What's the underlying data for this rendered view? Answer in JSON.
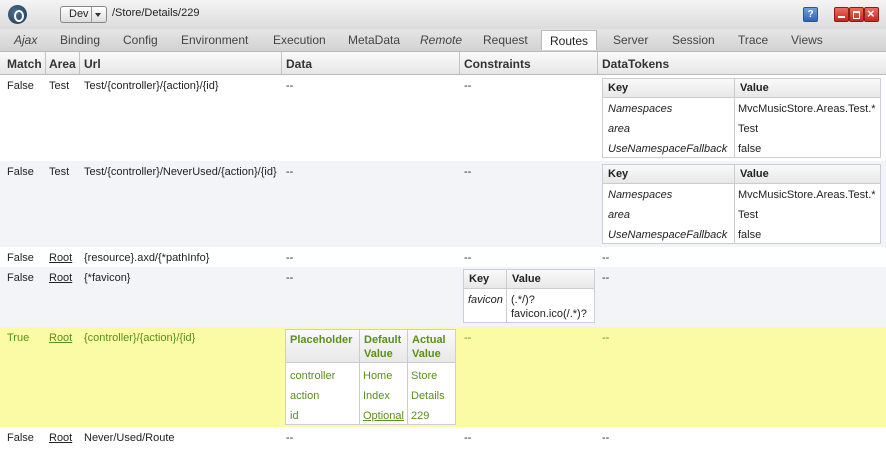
{
  "window": {
    "environment": "Dev",
    "path": "/Store/Details/229",
    "help_label": "?"
  },
  "tabs": [
    {
      "label": "Ajax",
      "italic": true
    },
    {
      "label": "Binding"
    },
    {
      "label": "Config"
    },
    {
      "label": "Environment"
    },
    {
      "label": "Execution"
    },
    {
      "label": "MetaData"
    },
    {
      "label": "Remote",
      "italic": true
    },
    {
      "label": "Request"
    },
    {
      "label": "Routes",
      "active": true
    },
    {
      "label": "Server"
    },
    {
      "label": "Session"
    },
    {
      "label": "Trace"
    },
    {
      "label": "Views"
    }
  ],
  "columns": [
    "Match",
    "Area",
    "Url",
    "Data",
    "Constraints",
    "DataTokens"
  ],
  "routes": [
    {
      "match": "False",
      "area": "Test",
      "url": "Test/{controller}/{action}/{id}",
      "data": "--",
      "constraints": "--",
      "datatokens": {
        "headers": [
          "Key",
          "Value"
        ],
        "rows": [
          [
            "Namespaces",
            "MvcMusicStore.Areas.Test.*"
          ],
          [
            "area",
            "Test"
          ],
          [
            "UseNamespaceFallback",
            "false"
          ]
        ]
      }
    },
    {
      "match": "False",
      "area": "Test",
      "url": "Test/{controller}/NeverUsed/{action}/{id}",
      "data": "--",
      "constraints": "--",
      "datatokens": {
        "headers": [
          "Key",
          "Value"
        ],
        "rows": [
          [
            "Namespaces",
            "MvcMusicStore.Areas.Test.*"
          ],
          [
            "area",
            "Test"
          ],
          [
            "UseNamespaceFallback",
            "false"
          ]
        ]
      }
    },
    {
      "match": "False",
      "area": "Root",
      "url": "{resource}.axd/{*pathInfo}",
      "data": "--",
      "constraints": "--",
      "datatokens_text": "--"
    },
    {
      "match": "False",
      "area": "Root",
      "url": "{*favicon}",
      "data": "--",
      "constraints_table": {
        "headers": [
          "Key",
          "Value"
        ],
        "rows": [
          [
            "favicon",
            "(.*/)?",
            "favicon.ico(/.*)?"
          ]
        ]
      },
      "datatokens_text": "--"
    },
    {
      "match": "True",
      "area": "Root",
      "url": "{controller}/{action}/{id}",
      "data_table": {
        "headers": [
          "Placeholder",
          "Default",
          "Value",
          "Actual",
          "Value"
        ],
        "rows": [
          [
            "controller",
            "Home",
            "Store"
          ],
          [
            "action",
            "Index",
            "Details"
          ],
          [
            "id",
            "Optional",
            "229"
          ]
        ]
      },
      "constraints": "--",
      "datatokens_text": "--"
    },
    {
      "match": "False",
      "area": "Root",
      "url": "Never/Used/Route",
      "data": "--",
      "constraints": "--",
      "datatokens_text": "--"
    }
  ]
}
